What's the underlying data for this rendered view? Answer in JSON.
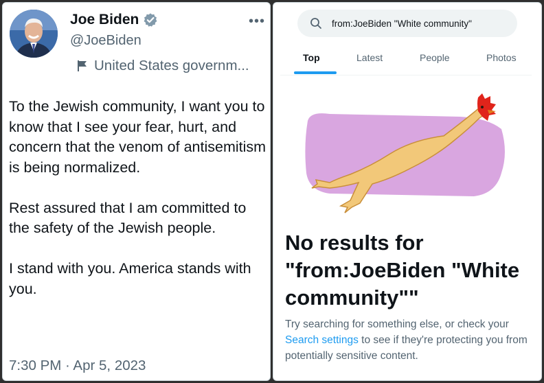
{
  "tweet": {
    "name": "Joe Biden",
    "handle": "@JoeBiden",
    "affiliation_label": "United States governm...",
    "text": "To the Jewish community, I want you to know that I see your fear, hurt, and concern that the venom of antisemitism is being normalized.\n\nRest assured that I am committed to the safety of the Jewish people.\n\nI stand with you. America stands with you.",
    "timestamp": "7:30 PM · Apr 5, 2023",
    "more_label": "•••"
  },
  "search": {
    "query": "from:JoeBiden \"White community\"",
    "tabs": [
      "Top",
      "Latest",
      "People",
      "Photos"
    ],
    "active_tab": "Top",
    "empty_title": "No results for \"from:JoeBiden \"White community\"\"",
    "empty_body_before": "Try searching for something else, or check your ",
    "empty_body_link": "Search settings",
    "empty_body_after": " to see if they're protecting you from potentially sensitive content."
  },
  "colors": {
    "accent": "#1d9bf0",
    "verified_badge": "#829aab",
    "illustration_bg": "#d9a6e0",
    "chicken_body": "#f2c879",
    "chicken_comb": "#e0241b"
  },
  "icons": {
    "verified": "verified-badge-icon",
    "flag": "flag-icon",
    "more": "more-icon",
    "search": "search-icon"
  }
}
